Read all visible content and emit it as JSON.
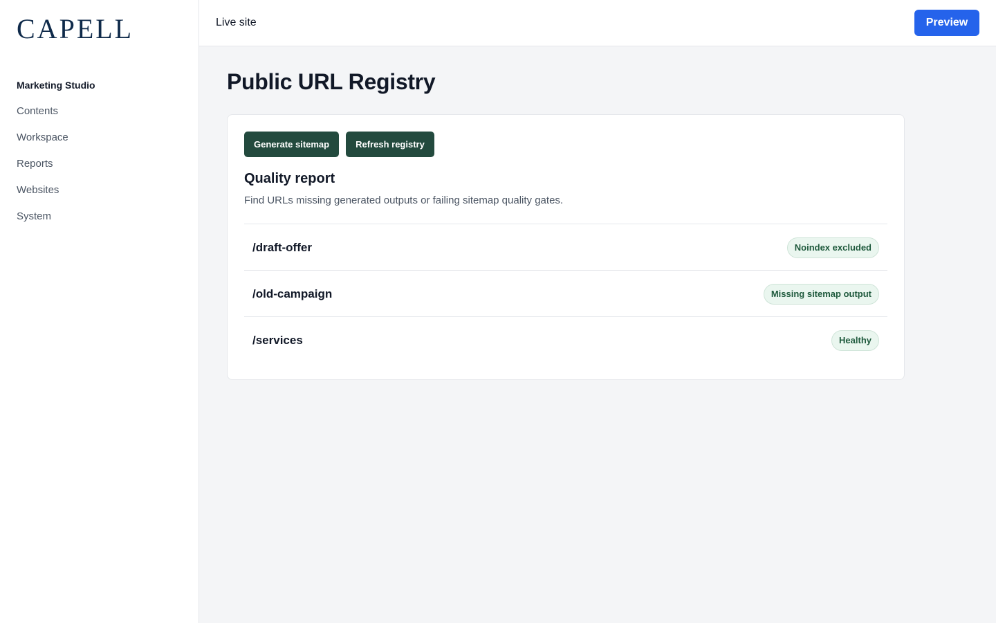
{
  "brand": {
    "logo_text": "CAPELL"
  },
  "sidebar": {
    "items": [
      {
        "label": "Marketing Studio",
        "active": true
      },
      {
        "label": "Contents"
      },
      {
        "label": "Workspace"
      },
      {
        "label": "Reports"
      },
      {
        "label": "Websites"
      },
      {
        "label": "System"
      }
    ]
  },
  "topbar": {
    "title": "Live site",
    "preview_label": "Preview"
  },
  "page": {
    "title": "Public URL Registry"
  },
  "actions": {
    "generate_label": "Generate sitemap",
    "refresh_label": "Refresh registry"
  },
  "report": {
    "title": "Quality report",
    "description": "Find URLs missing generated outputs or failing sitemap quality gates.",
    "rows": [
      {
        "path": "/draft-offer",
        "status": "Noindex excluded"
      },
      {
        "path": "/old-campaign",
        "status": "Missing sitemap output"
      },
      {
        "path": "/services",
        "status": "Healthy"
      }
    ]
  },
  "colors": {
    "accent": "#2563eb",
    "action": "#234a3e",
    "badge_bg": "#eaf6ef",
    "badge_text": "#1f5a3d",
    "logo": "#0f2a4a"
  }
}
